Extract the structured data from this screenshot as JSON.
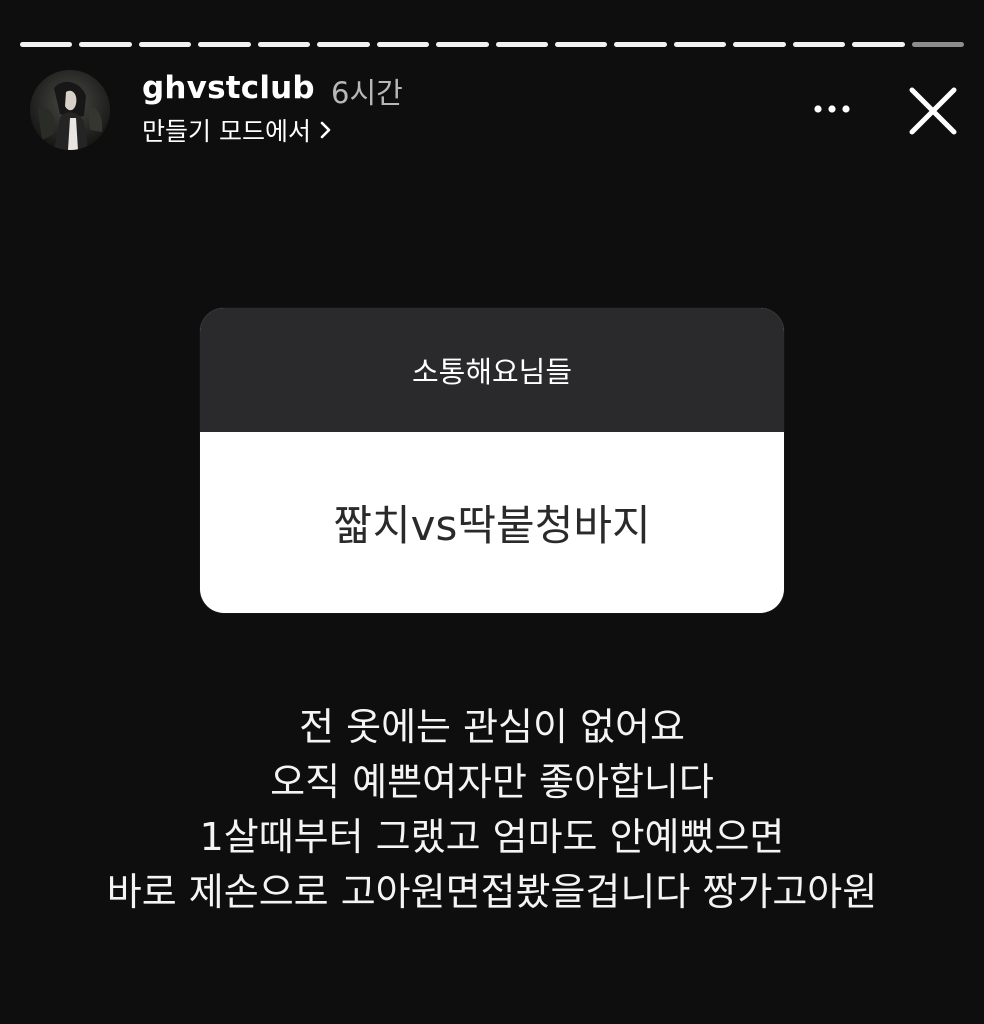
{
  "story": {
    "segments_total": 16,
    "segments_done": 15
  },
  "header": {
    "username": "ghvstclub",
    "time": "6시간",
    "mode_label": "만들기 모드에서",
    "icons": {
      "chevron": "chevron-right-icon",
      "more": "more-horizontal-icon",
      "close": "close-icon"
    }
  },
  "sticker": {
    "prompt": "소통해요님들",
    "answer": "짧치vs딱붙청바지"
  },
  "caption": {
    "lines": [
      "전 옷에는 관심이 없어요",
      "오직 예쁜여자만 좋아합니다",
      "1살때부터 그랬고 엄마도 안예뻤으면",
      "바로 제손으로 고아원면접봤을겁니다 짱가고아원"
    ]
  },
  "colors": {
    "background": "#0e0e0f",
    "sticker_header": "#2a2a2d",
    "sticker_body": "#ffffff",
    "progress_done": "#f2f2f2",
    "progress_pending": "#8d8d8d"
  }
}
